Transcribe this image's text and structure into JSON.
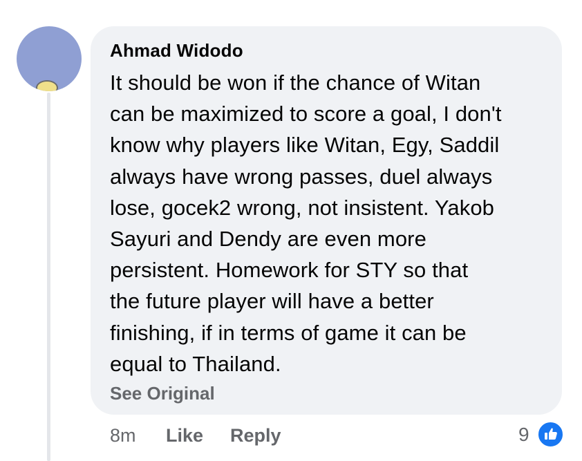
{
  "comment": {
    "author": "Ahmad Widodo",
    "text_lines": [
      "It should be won if the chance of Witan",
      "can be maximized to score a goal, I don't",
      "know why players like Witan, Egy, Saddil",
      "always have wrong passes, duel always",
      "lose, gocek2 wrong, not insistent. Yakob",
      "Sayuri and Dendy are even more",
      "persistent. Homework for STY so that",
      "the future player will have a better",
      "finishing, if in terms of game it can be",
      "equal to Thailand."
    ],
    "see_original": "See Original",
    "time": "8m",
    "like_label": "Like",
    "reply_label": "Reply",
    "reaction_count": "9",
    "reaction_icon": "thumbs-up-icon"
  },
  "colors": {
    "bubble_bg": "#f0f2f5",
    "primary_text": "#050505",
    "secondary_text": "#65676b",
    "like_blue": "#1877f2",
    "avatar_bg": "#8f9fd3"
  }
}
